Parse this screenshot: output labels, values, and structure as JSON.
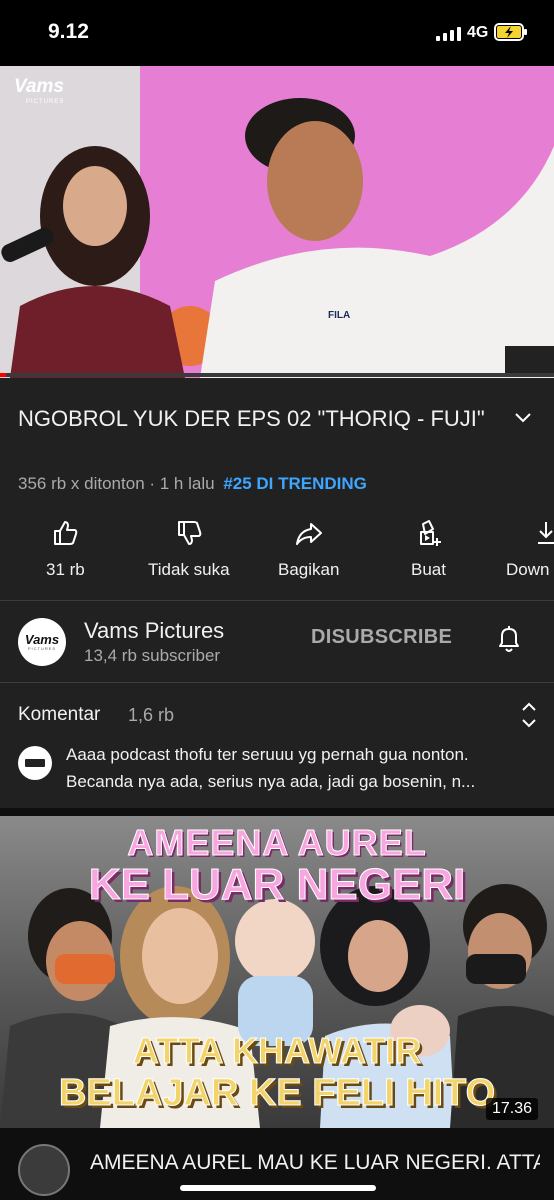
{
  "status_bar": {
    "time": "9.12",
    "network": "4G",
    "icons": [
      "signal-icon",
      "battery-charging-icon"
    ]
  },
  "player": {
    "channel_watermark": "Vams",
    "channel_watermark_sub": "PICTURES",
    "progress_fraction": 0.01
  },
  "video": {
    "title": "NGOBROL YUK DER EPS 02 \"THORIQ - FUJI\"",
    "views": "356 rb x ditonton · 1 h lalu",
    "trending": "#25 DI TRENDING"
  },
  "actions": [
    {
      "label": "31 rb",
      "icon": "like-icon"
    },
    {
      "label": "Tidak suka",
      "icon": "dislike-icon"
    },
    {
      "label": "Bagikan",
      "icon": "share-icon"
    },
    {
      "label": "Buat",
      "icon": "create-icon"
    },
    {
      "label": "Down",
      "icon": "download-icon"
    }
  ],
  "channel": {
    "name": "Vams Pictures",
    "subscribers": "13,4 rb subscriber",
    "subscribe_label": "DISUBSCRIBE",
    "avatar_text": "Vams",
    "avatar_sub": "PICTURES"
  },
  "comments": {
    "label": "Komentar",
    "count": "1,6 rb",
    "top_comment": "Aaaa podcast thofu ter seruuu yg pernah gua nonton. Becanda nya ada, serius nya ada, jadi ga bosenin, n..."
  },
  "next_video": {
    "thumb_line_1": "AMEENA AUREL",
    "thumb_line_2": "KE LUAR NEGERI",
    "thumb_line_3": "ATTA KHAWATIR",
    "thumb_line_4": "BELAJAR KE FELI HITO",
    "duration": "17.36",
    "title": "AMEENA AUREL MAU KE LUAR NEGERI. ATTA KHAWATIRBelajar d..."
  },
  "colors": {
    "background": "#212121",
    "accent_trending": "#3ea6ff",
    "progress": "#ff0000"
  }
}
